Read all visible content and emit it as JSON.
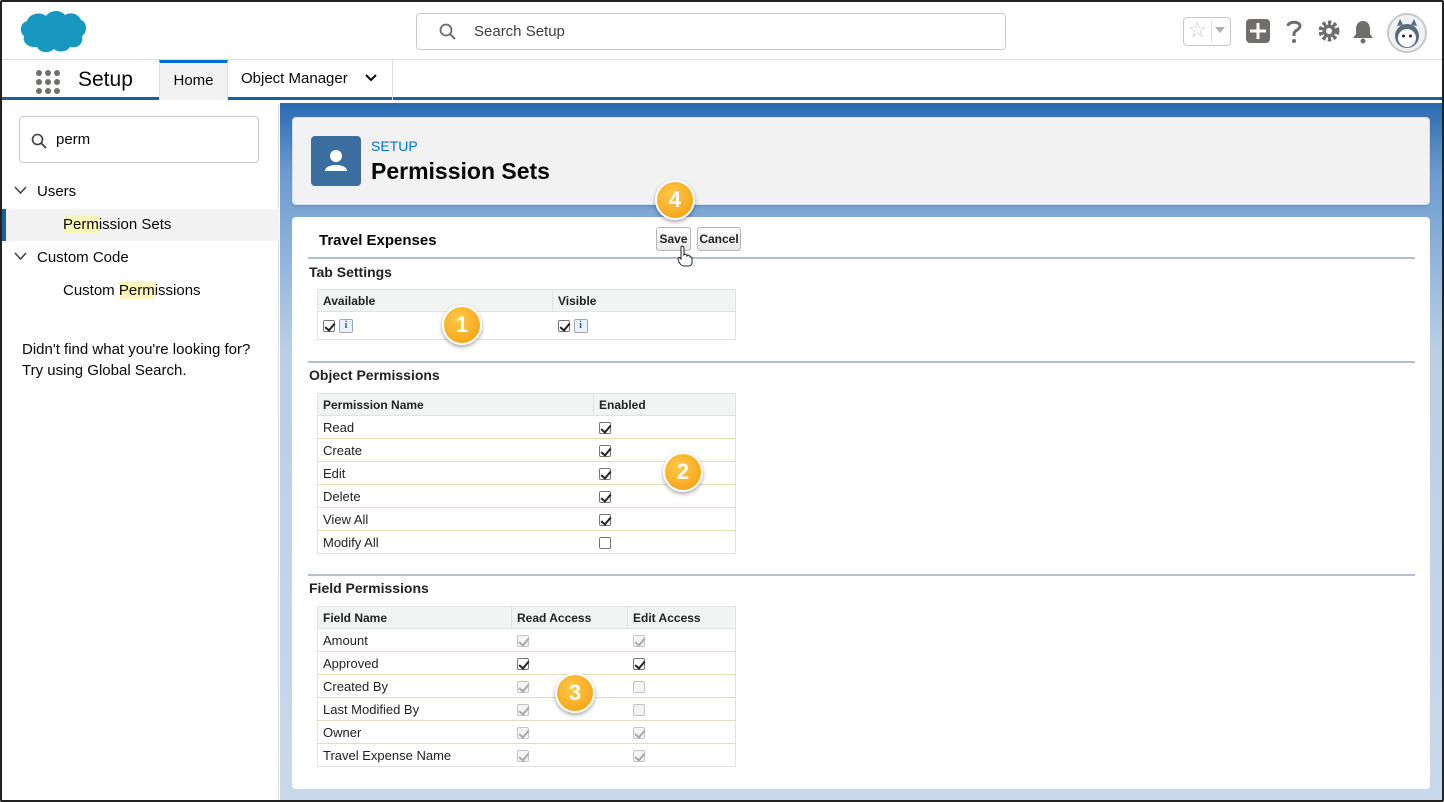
{
  "header": {
    "search_placeholder": "Search Setup",
    "icons": [
      "salesforce-cloud-logo",
      "search-icon",
      "star-icon",
      "add-icon",
      "help-icon",
      "setup-gear-icon",
      "notification-bell-icon",
      "avatar"
    ]
  },
  "nav": {
    "app_name": "Setup",
    "tabs": [
      {
        "label": "Home",
        "active": true
      },
      {
        "label": "Object Manager",
        "has_menu": true
      }
    ]
  },
  "sidebar": {
    "quick_find_value": "perm",
    "groups": [
      {
        "label": "Users",
        "items": [
          {
            "pre": "",
            "hl": "Perm",
            "post": "ission Sets",
            "active": true
          }
        ]
      },
      {
        "label": "Custom Code",
        "items": [
          {
            "pre": "Custom ",
            "hl": "Perm",
            "post": "issions",
            "active": false
          }
        ]
      }
    ],
    "not_found_line1": "Didn't find what you're looking for?",
    "not_found_line2": "Try using Global Search."
  },
  "page_header": {
    "kicker": "SETUP",
    "title": "Permission Sets"
  },
  "record": {
    "title": "Travel Expenses",
    "save_label": "Save",
    "cancel_label": "Cancel"
  },
  "tab_settings": {
    "title": "Tab Settings",
    "columns": [
      "Available",
      "Visible"
    ],
    "available_checked": true,
    "visible_checked": true,
    "info_glyph": "i"
  },
  "object_permissions": {
    "title": "Object Permissions",
    "columns": [
      "Permission Name",
      "Enabled"
    ],
    "rows": [
      {
        "name": "Read",
        "enabled": true
      },
      {
        "name": "Create",
        "enabled": true
      },
      {
        "name": "Edit",
        "enabled": true
      },
      {
        "name": "Delete",
        "enabled": true
      },
      {
        "name": "View All",
        "enabled": true
      },
      {
        "name": "Modify All",
        "enabled": false
      }
    ]
  },
  "field_permissions": {
    "title": "Field Permissions",
    "columns": [
      "Field Name",
      "Read Access",
      "Edit Access"
    ],
    "rows": [
      {
        "name": "Amount",
        "read": true,
        "read_disabled": true,
        "edit": true,
        "edit_disabled": true
      },
      {
        "name": "Approved",
        "read": true,
        "read_disabled": false,
        "edit": true,
        "edit_disabled": false
      },
      {
        "name": "Created By",
        "read": true,
        "read_disabled": true,
        "edit": false,
        "edit_disabled": true
      },
      {
        "name": "Last Modified By",
        "read": true,
        "read_disabled": true,
        "edit": false,
        "edit_disabled": true
      },
      {
        "name": "Owner",
        "read": true,
        "read_disabled": true,
        "edit": true,
        "edit_disabled": true
      },
      {
        "name": "Travel Expense Name",
        "read": true,
        "read_disabled": true,
        "edit": true,
        "edit_disabled": true
      }
    ]
  },
  "callouts": [
    "1",
    "2",
    "3",
    "4"
  ],
  "colors": {
    "brand_blue": "#0070d2",
    "nav_border": "#1b5f9e",
    "callout": "#f5a623"
  }
}
